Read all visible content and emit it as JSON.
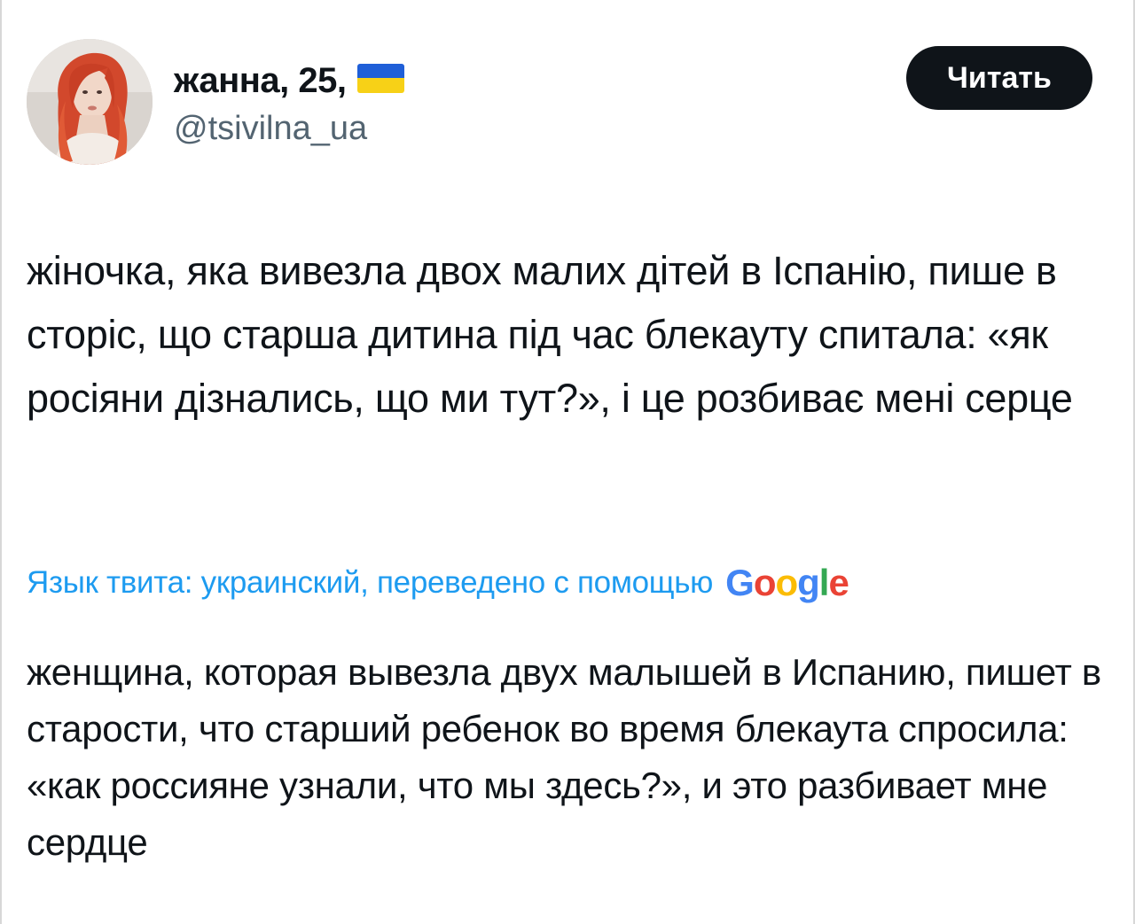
{
  "tweet": {
    "author": {
      "display_name": "жанна, 25,",
      "handle": "@tsivilna_ua",
      "flag_icon": "ukraine-flag-icon",
      "avatar_icon": "user-avatar"
    },
    "follow_button_label": "Читать",
    "text": "жіночка, яка вивезла двох малих дітей в Іспанію, пише в сторіс, що старша дитина під час блекауту спитала: «як росіяни дізнались, що ми тут?», і це розбиває мені серце",
    "translation": {
      "label": "Язык твита: украинский, переведено с помощью",
      "provider_letters": [
        "G",
        "o",
        "o",
        "g",
        "l",
        "e"
      ],
      "text": "женщина, которая вывезла двух малышей в Испанию, пишет в старости, что старший ребенок во время блекаута спросила: «как россияне узнали, что мы здесь?», и это разбивает мне сердце"
    }
  },
  "colors": {
    "text": "#0f1419",
    "secondary": "#536471",
    "link": "#1d9bf0",
    "button_bg": "#0f1419",
    "button_text": "#ffffff",
    "flag_blue": "#1f5fd8",
    "flag_yellow": "#f7d117"
  }
}
